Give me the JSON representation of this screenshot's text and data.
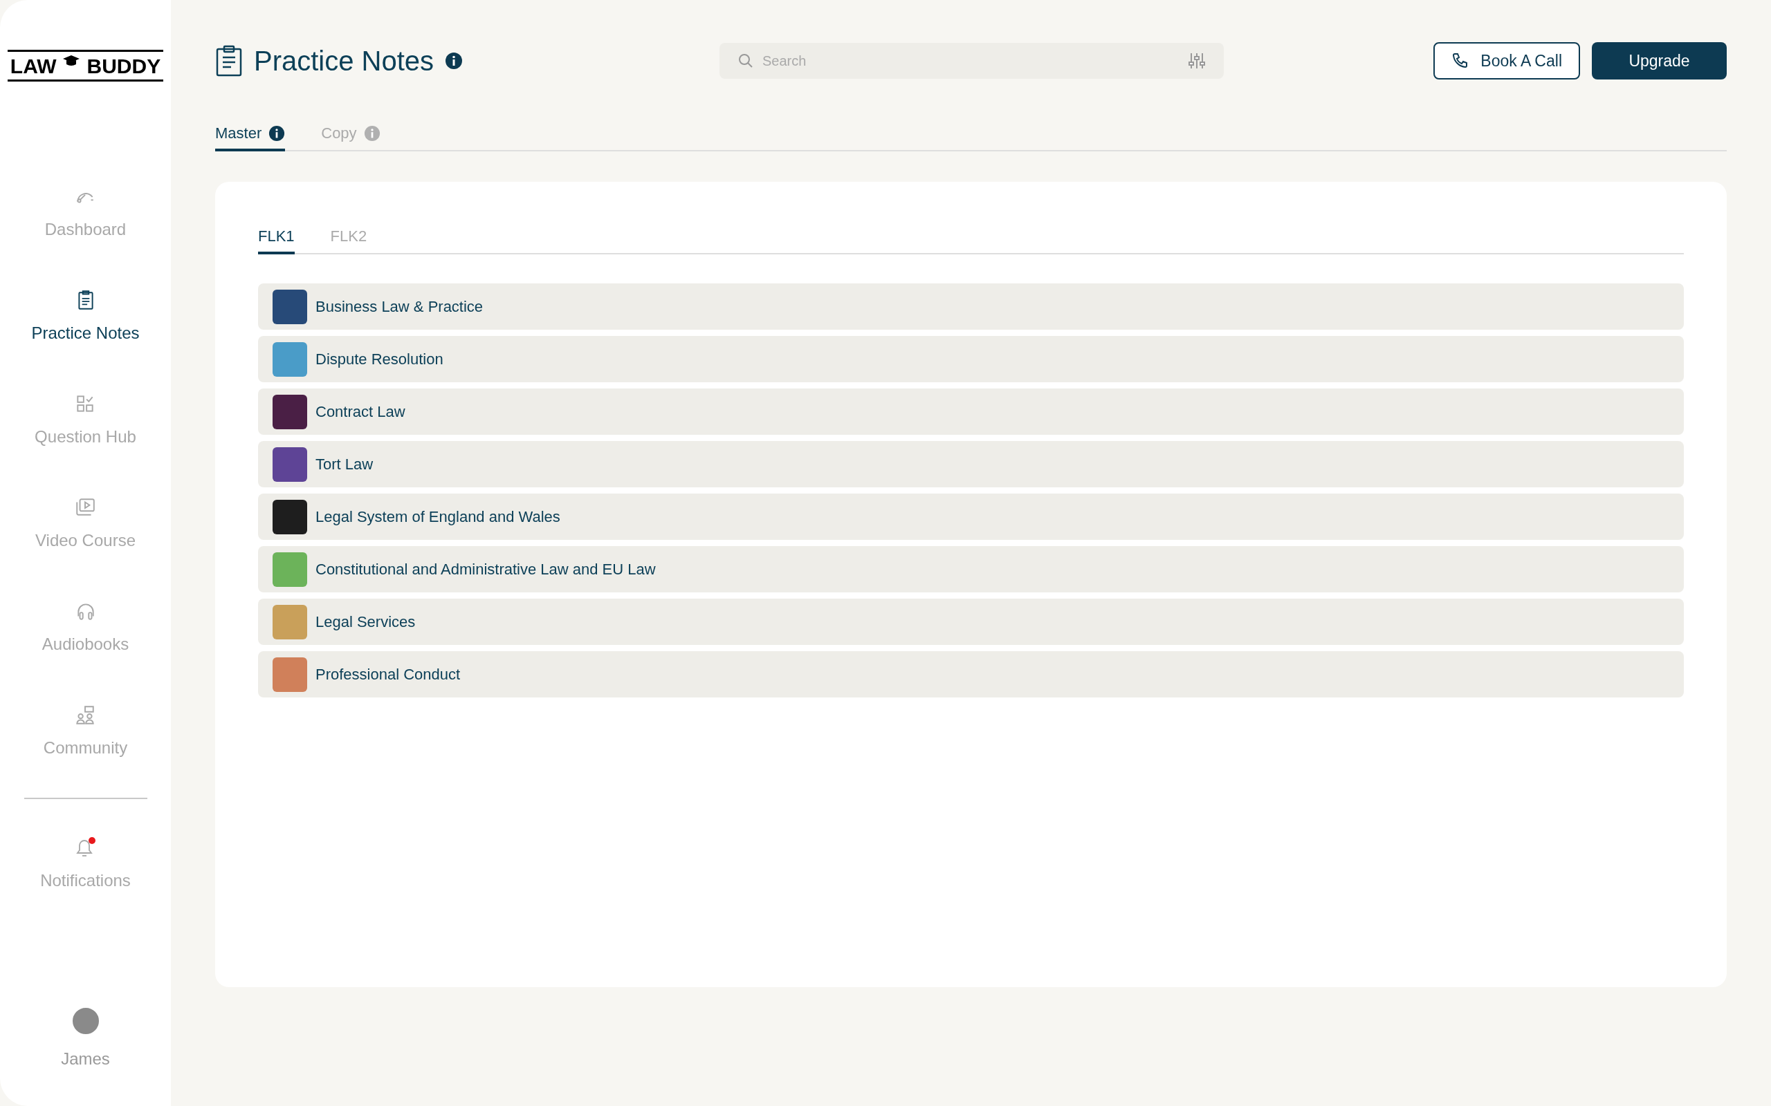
{
  "logo": {
    "left": "LAW",
    "right": "BUDDY"
  },
  "sidebar": {
    "items": [
      {
        "label": "Dashboard",
        "selected": false
      },
      {
        "label": "Practice Notes",
        "selected": true
      },
      {
        "label": "Question Hub",
        "selected": false
      },
      {
        "label": "Video Course",
        "selected": false
      },
      {
        "label": "Audiobooks",
        "selected": false
      },
      {
        "label": "Community",
        "selected": false
      }
    ],
    "notifications": {
      "label": "Notifications",
      "unread": true
    },
    "user": {
      "name": "James"
    }
  },
  "header": {
    "title": "Practice Notes",
    "search": {
      "placeholder": "Search"
    },
    "buttons": [
      {
        "label": "Book A Call",
        "kind": "outline"
      },
      {
        "label": "Upgrade",
        "kind": "primary"
      }
    ]
  },
  "tabs": [
    {
      "label": "Master",
      "selected": true
    },
    {
      "label": "Copy",
      "selected": false
    }
  ],
  "subtabs": [
    {
      "label": "FLK1",
      "selected": true
    },
    {
      "label": "FLK2",
      "selected": false
    }
  ],
  "subjects": [
    {
      "title": "Business Law & Practice",
      "color": "#274a78"
    },
    {
      "title": "Dispute Resolution",
      "color": "#4a9cc8"
    },
    {
      "title": "Contract Law",
      "color": "#4a1f45"
    },
    {
      "title": "Tort Law",
      "color": "#5e4496"
    },
    {
      "title": "Legal System of England and Wales",
      "color": "#1e1e1e"
    },
    {
      "title": "Constitutional and Administrative Law and EU Law",
      "color": "#6cb35a"
    },
    {
      "title": "Legal Services",
      "color": "#c9a05a"
    },
    {
      "title": "Professional Conduct",
      "color": "#d0805a"
    }
  ]
}
